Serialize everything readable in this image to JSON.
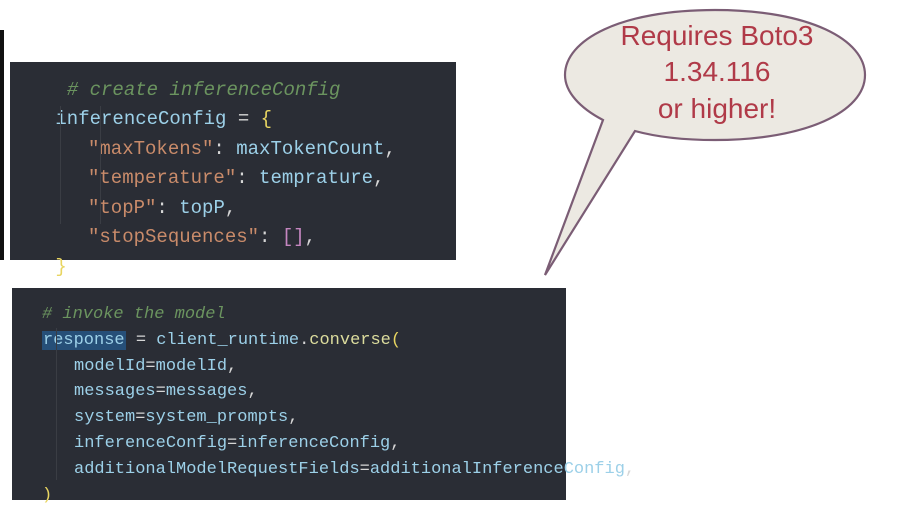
{
  "block1": {
    "comment": "# create inferenceConfig",
    "assign_left": "inferenceConfig",
    "eq": " = ",
    "open": "{",
    "entries": [
      {
        "key": "\"maxTokens\"",
        "colon": ": ",
        "value": "maxTokenCount",
        "comma": ","
      },
      {
        "key": "\"temperature\"",
        "colon": ": ",
        "value": "temprature",
        "comma": ","
      },
      {
        "key": "\"topP\"",
        "colon": ": ",
        "value": "topP",
        "comma": ","
      },
      {
        "key": "\"stopSequences\"",
        "colon": ": ",
        "open": "[",
        "close": "]",
        "comma": ","
      }
    ],
    "close": "}"
  },
  "block2": {
    "comment": "# invoke the model",
    "response": "response",
    "eq": " = ",
    "client": "client_runtime",
    "dot": ".",
    "method": "converse",
    "open": "(",
    "args": [
      {
        "name": "modelId",
        "eq": "=",
        "value": "modelId",
        "comma": ","
      },
      {
        "name": "messages",
        "eq": "=",
        "value": "messages",
        "comma": ","
      },
      {
        "name": "system",
        "eq": "=",
        "value": "system_prompts",
        "comma": ","
      },
      {
        "name": "inferenceConfig",
        "eq": "=",
        "value": "inferenceConfig",
        "comma": ","
      },
      {
        "name": "additionalModelRequestFields",
        "eq": "=",
        "value": "additionalInferenceConfig",
        "comma": ","
      }
    ],
    "close": ")"
  },
  "callout": {
    "line1": "Requires Boto3",
    "line2": "1.34.116",
    "line3": "or higher!"
  }
}
